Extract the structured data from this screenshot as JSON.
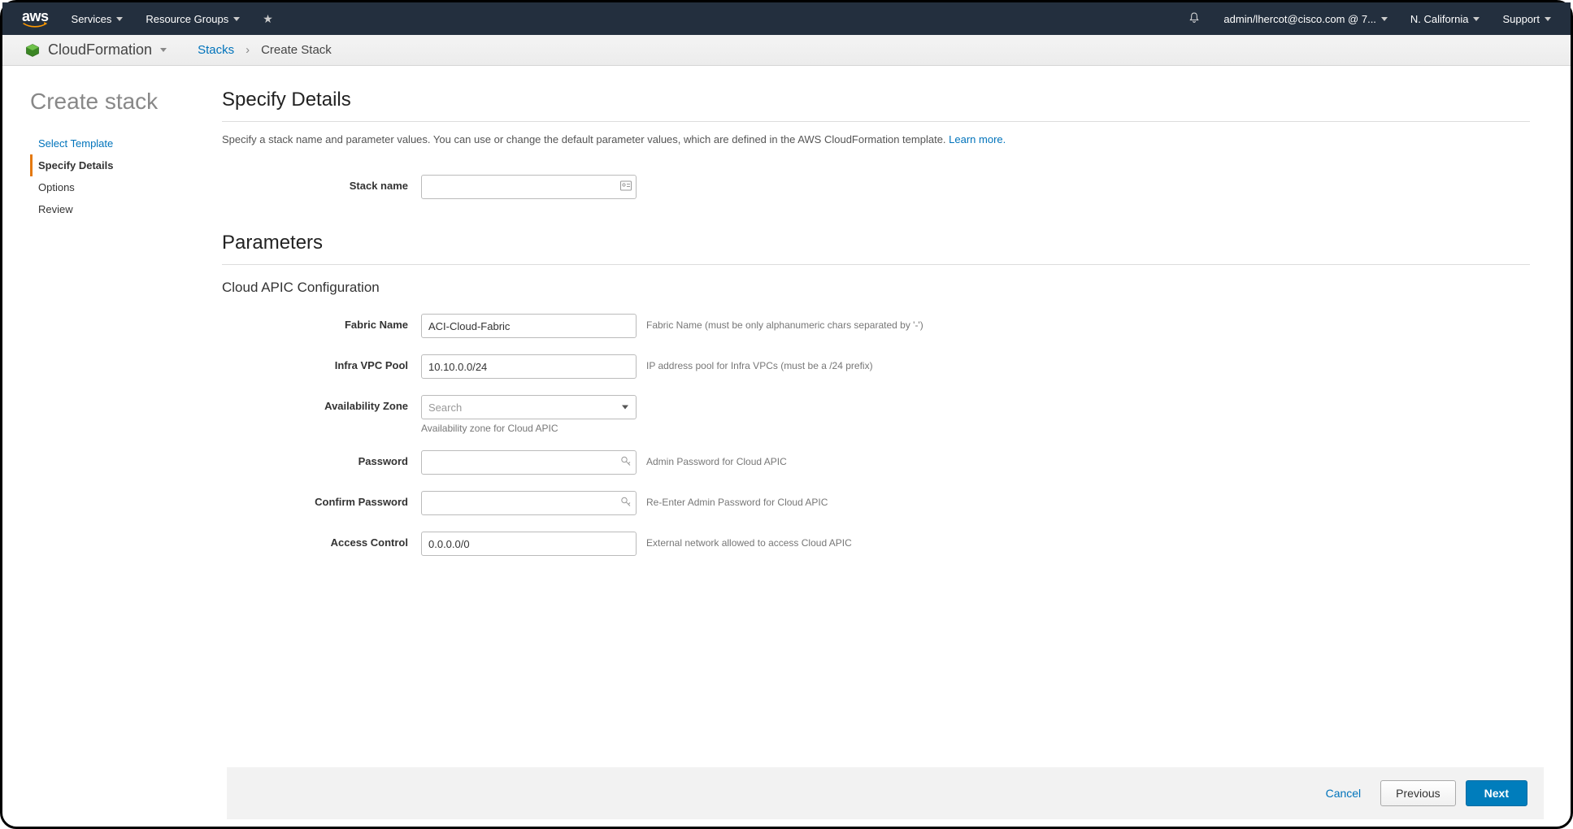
{
  "topnav": {
    "logo": "aws",
    "services": "Services",
    "resource_groups": "Resource Groups",
    "user": "admin/lhercot@cisco.com @ 7...",
    "region": "N. California",
    "support": "Support"
  },
  "servicebar": {
    "service": "CloudFormation",
    "crumb_stacks": "Stacks",
    "crumb_create": "Create Stack"
  },
  "page": {
    "title": "Create stack"
  },
  "wizard": {
    "steps": [
      "Select Template",
      "Specify Details",
      "Options",
      "Review"
    ],
    "active_index": 1
  },
  "section": {
    "heading": "Specify Details",
    "description": "Specify a stack name and parameter values. You can use or change the default parameter values, which are defined in the AWS CloudFormation template. ",
    "learn_more": "Learn more."
  },
  "stack_name": {
    "label": "Stack name",
    "value": ""
  },
  "parameters": {
    "heading": "Parameters",
    "subheading": "Cloud APIC Configuration",
    "fabric_name": {
      "label": "Fabric Name",
      "value": "ACI-Cloud-Fabric",
      "hint": "Fabric Name (must be only alphanumeric chars separated by '-')"
    },
    "infra_vpc_pool": {
      "label": "Infra VPC Pool",
      "value": "10.10.0.0/24",
      "hint": "IP address pool for Infra VPCs (must be a /24 prefix)"
    },
    "availability_zone": {
      "label": "Availability Zone",
      "placeholder": "Search",
      "hint": "Availability zone for Cloud APIC"
    },
    "password": {
      "label": "Password",
      "value": "",
      "hint": "Admin Password for Cloud APIC"
    },
    "confirm_password": {
      "label": "Confirm Password",
      "value": "",
      "hint": "Re-Enter Admin Password for Cloud APIC"
    },
    "access_control": {
      "label": "Access Control",
      "value": "0.0.0.0/0",
      "hint": "External network allowed to access Cloud APIC"
    }
  },
  "footer": {
    "cancel": "Cancel",
    "previous": "Previous",
    "next": "Next"
  }
}
